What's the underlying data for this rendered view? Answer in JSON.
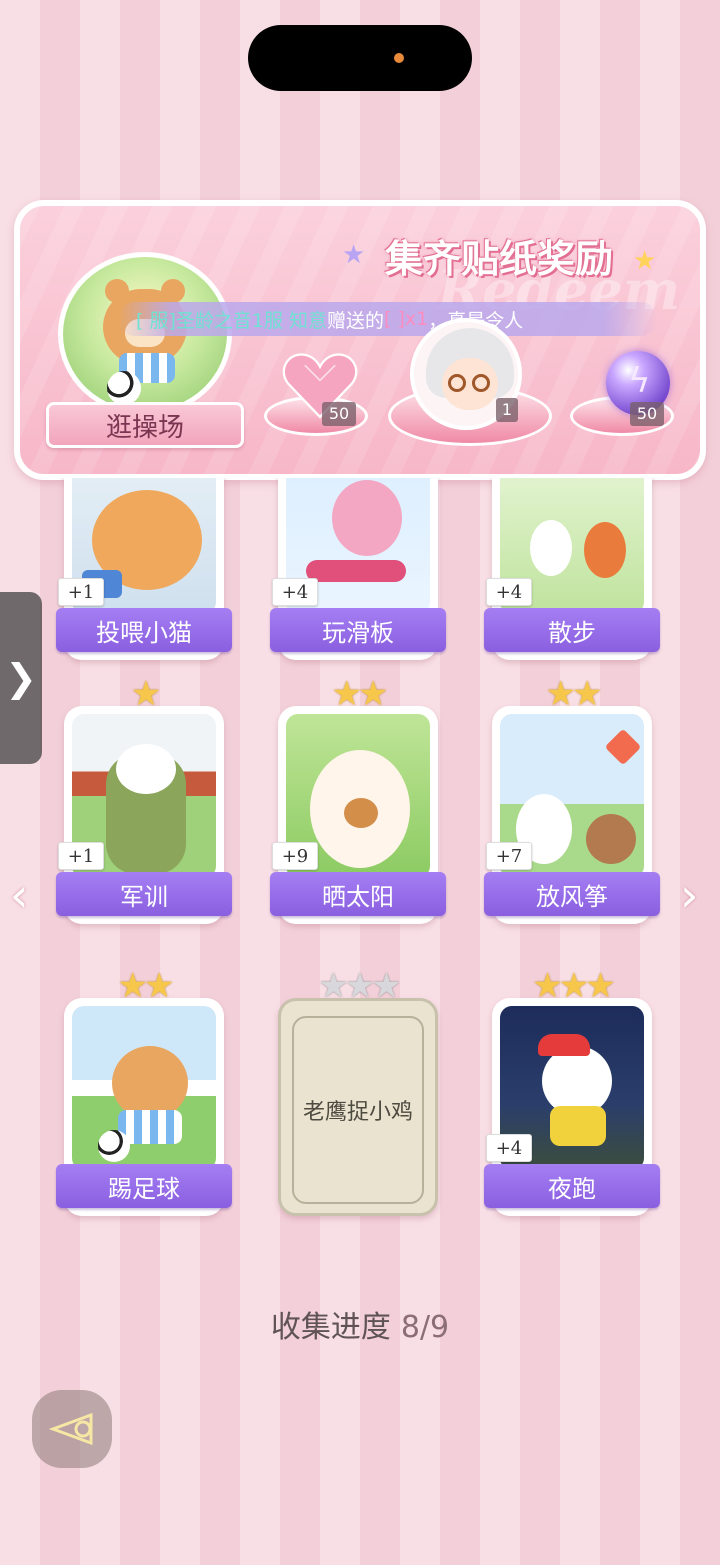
{
  "panel": {
    "title": "集齐贴纸奖励",
    "ghost_text": "Redeem",
    "badge_label": "逛操场",
    "ticker": {
      "user": "[ 服]圣龄之音1服 知意",
      "verb": "赠送的",
      "item": "[ ]x1",
      "suffix": "，真是令人"
    },
    "rewards": [
      {
        "icon": "heart-gem-icon",
        "qty": "50"
      },
      {
        "icon": "character-avatar",
        "qty": "1"
      },
      {
        "icon": "lightning-orb-icon",
        "qty": "50"
      }
    ]
  },
  "cards": [
    {
      "label": "投喂小猫",
      "plus": "+1",
      "stars": ""
    },
    {
      "label": "玩滑板",
      "plus": "+4",
      "stars": ""
    },
    {
      "label": "散步",
      "plus": "+4",
      "stars": ""
    },
    {
      "label": "军训",
      "plus": "+1",
      "stars": "★"
    },
    {
      "label": "晒太阳",
      "plus": "+9",
      "stars": "★★"
    },
    {
      "label": "放风筝",
      "plus": "+7",
      "stars": "★★"
    },
    {
      "label": "踢足球",
      "plus": "",
      "stars": "★★"
    },
    {
      "label": "老鹰捉小鸡",
      "plus": "",
      "stars": "★★★",
      "locked": true
    },
    {
      "label": "夜跑",
      "plus": "+4",
      "stars": "★★★"
    }
  ],
  "progress": {
    "label": "收集进度",
    "value": "8/9"
  },
  "nav": {
    "side_tab": "❯",
    "prev": "‹",
    "next": "›"
  }
}
